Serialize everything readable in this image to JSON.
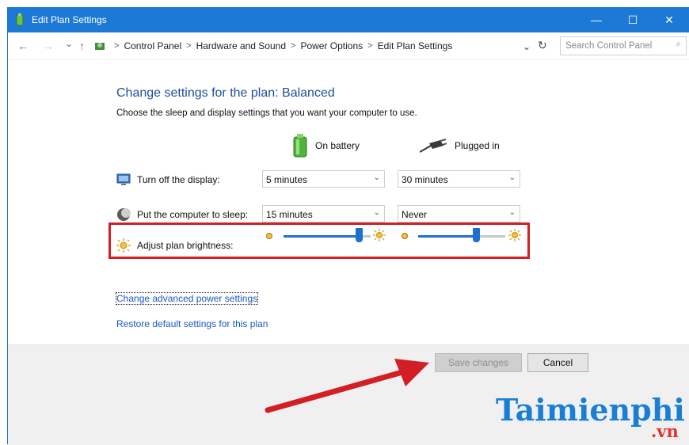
{
  "window": {
    "title": "Edit Plan Settings",
    "minimize_glyph": "—",
    "maximize_glyph": "☐",
    "close_glyph": "✕"
  },
  "nav": {
    "back": "←",
    "forward": "→",
    "recent": "⌄",
    "up": "↑"
  },
  "address": {
    "separator": ">",
    "crumbs": [
      "Control Panel",
      "Hardware and Sound",
      "Power Options",
      "Edit Plan Settings"
    ],
    "dropdown_glyph": "⌄",
    "refresh_glyph": "↻"
  },
  "search": {
    "placeholder": "Search Control Panel",
    "icon_glyph": "⌕"
  },
  "plan": {
    "heading": "Change settings for the plan: Balanced",
    "subheading": "Choose the sleep and display settings that you want your computer to use.",
    "col_battery": "On battery",
    "col_plugged": "Plugged in",
    "display_label": "Turn off the display:",
    "display_battery": "5 minutes",
    "display_plugged": "30 minutes",
    "sleep_label": "Put the computer to sleep:",
    "sleep_battery": "15 minutes",
    "sleep_plugged": "Never",
    "brightness_label": "Adjust plan brightness:",
    "brightness_battery": 0.9,
    "brightness_plugged": 0.68,
    "chevron": "⌄"
  },
  "links": {
    "advanced": "Change advanced power settings",
    "restore": "Restore default settings for this plan"
  },
  "buttons": {
    "save": "Save changes",
    "cancel": "Cancel"
  },
  "watermark": {
    "brand": "Taimienphi",
    "suffix": ".vn"
  },
  "colors": {
    "titlebar": "#1c7ad6",
    "heading": "#1f4e9c",
    "link": "#1a57c4",
    "highlight": "#d21f26",
    "slider": "#1f6fd1"
  }
}
